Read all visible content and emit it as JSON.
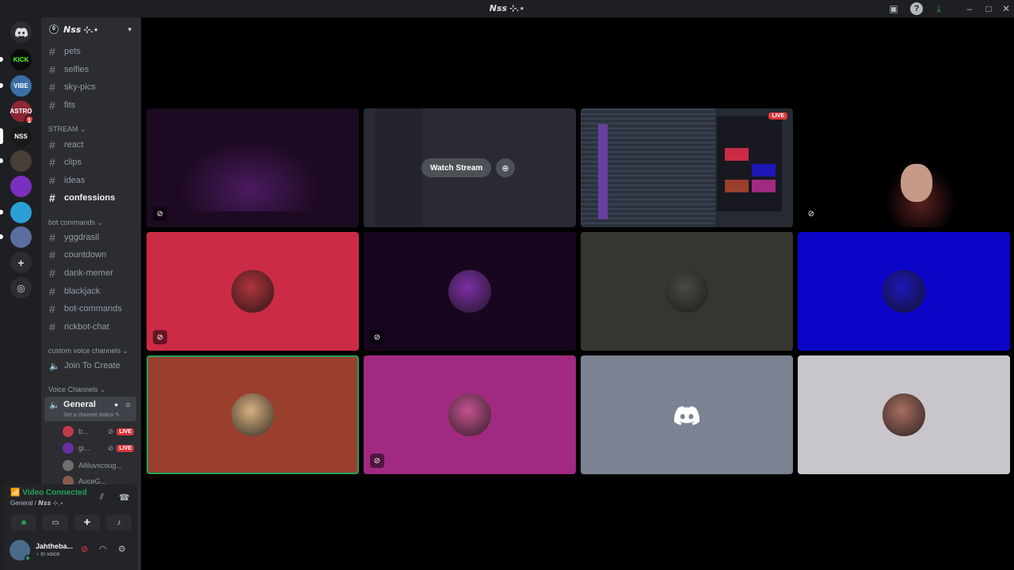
{
  "window": {
    "title": "𝙉𝙨𝙨 ⊹.⋆"
  },
  "servers": [
    {
      "label": "KICK",
      "color": "#0b0b0b",
      "text_color": "#53fc18"
    },
    {
      "label": "VIBE",
      "color": "#3a6ea5"
    },
    {
      "label": "ASTRO",
      "color": "#8b2635",
      "badge": "1"
    },
    {
      "label": "NSS",
      "color": "#1a1a1a"
    },
    {
      "label": "",
      "color": "#4a3f35"
    },
    {
      "label": "",
      "color": "#7b2fbe"
    },
    {
      "label": "",
      "color": "#2a9fd6"
    },
    {
      "label": "",
      "color": "#5a6fa0"
    }
  ],
  "guild": {
    "name": "𝙉𝙨𝙨 ⊹.⋆",
    "icon": "0"
  },
  "channels": {
    "top": [
      "pets",
      "selfies",
      "sky-pics",
      "fits"
    ],
    "stream_category": "STREAM",
    "stream": [
      "react",
      "clips",
      "ideas",
      "confessions"
    ],
    "bot_category": "bot commands",
    "bot": [
      "yggdrasil",
      "countdown",
      "dank-memer",
      "blackjack",
      "bot-commands",
      "rickbot-chat"
    ],
    "custom_category": "custom voice channels",
    "custom_voice": "Join To Create",
    "voice_category": "Voice Channels",
    "general": {
      "name": "General",
      "status": "Set a channel status"
    },
    "voice_users": [
      {
        "name": "b...",
        "live": "LIVE",
        "color": "#c0394b"
      },
      {
        "name": "gi...",
        "live": "LIVE",
        "color": "#6b2fa0"
      },
      {
        "name": "Alliluvscoug...",
        "live": "",
        "color": "#6e6e6e"
      },
      {
        "name": "AuceG...",
        "live": "",
        "color": "#8a5a4a"
      }
    ]
  },
  "panel": {
    "status": "Video Connected",
    "location": "General / 𝙉𝙨𝙨 ⊹.⋆",
    "username": "Jahtheba...",
    "userstatus": "In voice"
  },
  "stream": {
    "watch_label": "Watch Stream",
    "live_label": "LIVE"
  },
  "tiles": [
    {
      "bg": "#1d0a22",
      "muted": true,
      "kind": "video"
    },
    {
      "bg": "#2a2a33",
      "muted": false,
      "kind": "stream-preview"
    },
    {
      "bg": "#252a33",
      "muted": false,
      "kind": "live-stream"
    },
    {
      "bg": "#000000",
      "muted": true,
      "kind": "camera"
    },
    {
      "bg": "#cc2b45",
      "muted": true,
      "kind": "avatar",
      "avatar": "#b0343c"
    },
    {
      "bg": "#18061f",
      "muted": true,
      "kind": "avatar",
      "avatar": "#7d2fa5"
    },
    {
      "bg": "#363630",
      "muted": false,
      "kind": "avatar",
      "avatar": "#4a4a44"
    },
    {
      "bg": "#0c05c8",
      "muted": false,
      "kind": "avatar",
      "avatar": "#1d17b8"
    },
    {
      "bg": "#9a3f2e",
      "muted": false,
      "kind": "avatar",
      "avatar": "#d8b080",
      "speaking": true
    },
    {
      "bg": "#a12a80",
      "muted": true,
      "kind": "avatar",
      "avatar": "#c5538f"
    },
    {
      "bg": "#7b8291",
      "muted": false,
      "kind": "discord-logo"
    },
    {
      "bg": "#c8c6ca",
      "muted": false,
      "kind": "avatar",
      "avatar": "#a96e62"
    }
  ]
}
